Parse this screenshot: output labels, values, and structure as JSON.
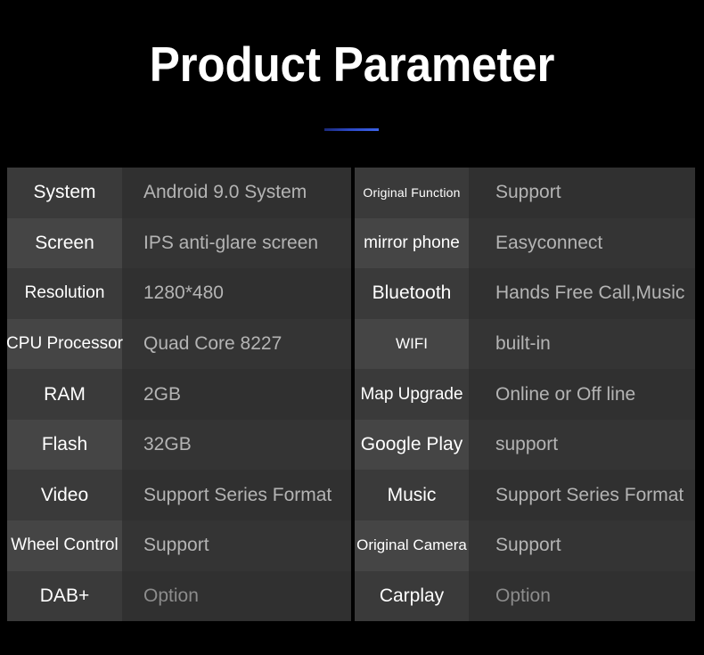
{
  "header": {
    "title": "Product Parameter",
    "accent_color": "#3c63e8"
  },
  "colors": {
    "background": "#000000",
    "label_cell_a": "#3a3a3a",
    "label_cell_b": "#454545",
    "value_cell_a": "#303030",
    "value_cell_b": "#343434",
    "label_text": "#ffffff",
    "value_text": "#b4b4b4",
    "value_text_dim": "#8c8c8c"
  },
  "spec_table": {
    "left": [
      {
        "label": "System",
        "value": "Android 9.0 System"
      },
      {
        "label": "Screen",
        "value": "IPS anti-glare screen"
      },
      {
        "label": "Resolution",
        "value": "1280*480"
      },
      {
        "label": "CPU Processor",
        "value": "Quad Core 8227"
      },
      {
        "label": "RAM",
        "value": "2GB"
      },
      {
        "label": "Flash",
        "value": "32GB"
      },
      {
        "label": "Video",
        "value": "Support Series Format"
      },
      {
        "label": "Wheel Control",
        "value": "Support"
      },
      {
        "label": "DAB+",
        "value": "Option"
      }
    ],
    "right": [
      {
        "label": "Original Function",
        "value": "Support"
      },
      {
        "label": "mirror phone",
        "value": "Easyconnect"
      },
      {
        "label": "Bluetooth",
        "value": "Hands Free Call,Music"
      },
      {
        "label": "WIFI",
        "value": "built-in"
      },
      {
        "label": "Map Upgrade",
        "value": "Online or Off line"
      },
      {
        "label": "Google Play",
        "value": "support"
      },
      {
        "label": "Music",
        "value": "Support Series Format"
      },
      {
        "label": "Original Camera",
        "value": "Support"
      },
      {
        "label": "Carplay",
        "value": "Option"
      }
    ]
  }
}
